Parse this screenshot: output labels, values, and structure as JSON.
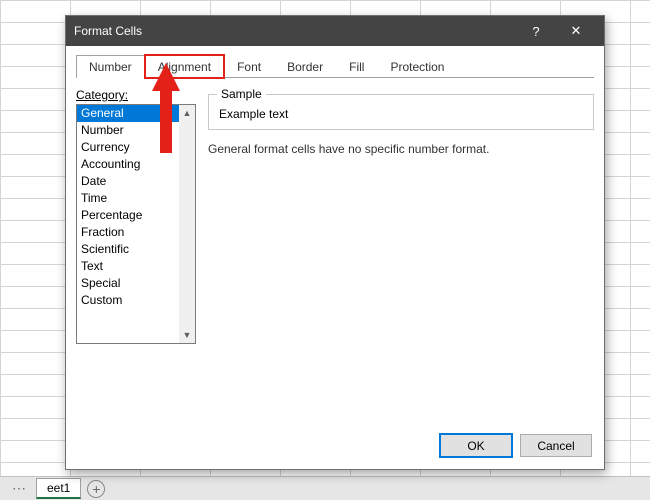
{
  "sheet": {
    "tab_name": "eet1"
  },
  "dialog": {
    "title": "Format Cells",
    "help_label": "?",
    "close_label": "✕",
    "tabs": {
      "number": "Number",
      "alignment": "Alignment",
      "font": "Font",
      "border": "Border",
      "fill": "Fill",
      "protection": "Protection"
    },
    "category_label": "Category:",
    "categories": [
      "General",
      "Number",
      "Currency",
      "Accounting",
      "Date",
      "Time",
      "Percentage",
      "Fraction",
      "Scientific",
      "Text",
      "Special",
      "Custom"
    ],
    "selected_category_index": 0,
    "sample": {
      "label": "Sample",
      "value": "Example text"
    },
    "description": "General format cells have no specific number format.",
    "buttons": {
      "ok": "OK",
      "cancel": "Cancel"
    }
  }
}
